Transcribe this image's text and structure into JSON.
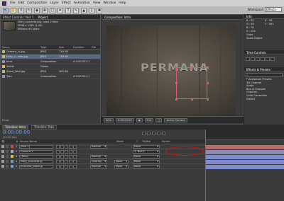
{
  "menu": [
    "File",
    "Edit",
    "Composition",
    "Layer",
    "Effect",
    "Animation",
    "View",
    "Window",
    "Help"
  ],
  "workspace": {
    "label": "Workspace:",
    "value": "Effects"
  },
  "project": {
    "tabs": [
      "Effect Controls: Null 1",
      "Project"
    ],
    "selected_file": "Dirty_concrete.jpg",
    "used_times": ", used 1 time",
    "dims": "2048 x 1536 (1.00)",
    "colors": "Millions of Colors",
    "headers": [
      "Name",
      "Type",
      "Size",
      "Duration",
      "File"
    ],
    "rows": [
      {
        "name": "Cement_ k.jpg",
        "type": "JPEG",
        "size": "730 KB",
        "dur": "",
        "icon": "image-icon"
      },
      {
        "name": "Dirty_c...rete.jpg",
        "type": "JPEG",
        "size": "736 KB",
        "dur": "",
        "icon": "image-icon",
        "sel": true
      },
      {
        "name": "Intro",
        "type": "Composition",
        "size": "",
        "dur": "Δ 0:00:20:11",
        "icon": "composition-icon"
      },
      {
        "name": "Solids",
        "type": "Folder",
        "size": "",
        "dur": "",
        "icon": "folder-icon"
      },
      {
        "name": "Stone_Wall.jpg",
        "type": "JPEG",
        "size": "589 KB",
        "dur": "",
        "icon": "image-icon"
      },
      {
        "name": "Teks",
        "type": "Composition",
        "size": "",
        "dur": "Δ 0:00:20:11",
        "icon": "composition-icon"
      }
    ],
    "bpc": "8 bpc"
  },
  "composition": {
    "tab": "Composition: Intro",
    "title": "PERMANA",
    "zoom": "50%",
    "time": "0:00:00:00",
    "camera": "Active Camera",
    "res": "Full"
  },
  "info": {
    "tab": "Info",
    "R": "R : 92",
    "G": "G : 83",
    "B": "B : 76",
    "A": "A : 255",
    "X": "X : 94",
    "Y": "Y : 491",
    "undo": "Undo",
    "undo_action": "Scale Object"
  },
  "time_controls": {
    "tab": "Time Controls"
  },
  "effects": {
    "tab": "Effects & Presets",
    "search": "⌕",
    "items": [
      "* Animation Presets",
      "3D Channel",
      "Audio",
      "Blur & Sharpen",
      "Channel",
      "Color Correction",
      "Distort"
    ]
  },
  "timeline": {
    "tabs": [
      "Timeline: Intro",
      "Timeline: Teks"
    ],
    "timecode": "0:00:00:00",
    "fps": "(25.00 fps)",
    "headers": [
      "#",
      "Source Name",
      "Mode",
      "T",
      "TrkMat",
      "Parent"
    ],
    "layers": [
      {
        "num": "1",
        "name": "[Null 1]",
        "mode": "Normal",
        "trk": "",
        "parent": "None",
        "color": "#c94848",
        "track": "#b86a6a"
      },
      {
        "num": "2",
        "name": "Camera 1",
        "mode": "",
        "trk": "",
        "parent": "1. Null 1",
        "color": "#a8a8a8",
        "track": "#8a8ab8"
      },
      {
        "num": "3",
        "name": "[Teks]",
        "mode": "Normal",
        "trk": "",
        "parent": "None",
        "color": "#d5c23a",
        "track": "#7f8bd0"
      },
      {
        "num": "4",
        "name": "Dirty_concrete.jp",
        "mode": "Overlay",
        "trk": "None",
        "parent": "None",
        "color": "#6a9bd0",
        "track": "#7f8bd0"
      },
      {
        "num": "5",
        "name": "[Cement_block.jp",
        "mode": "Normal",
        "trk": "None",
        "parent": "None",
        "color": "#6a9bd0",
        "track": "#7f8bd0"
      }
    ]
  }
}
